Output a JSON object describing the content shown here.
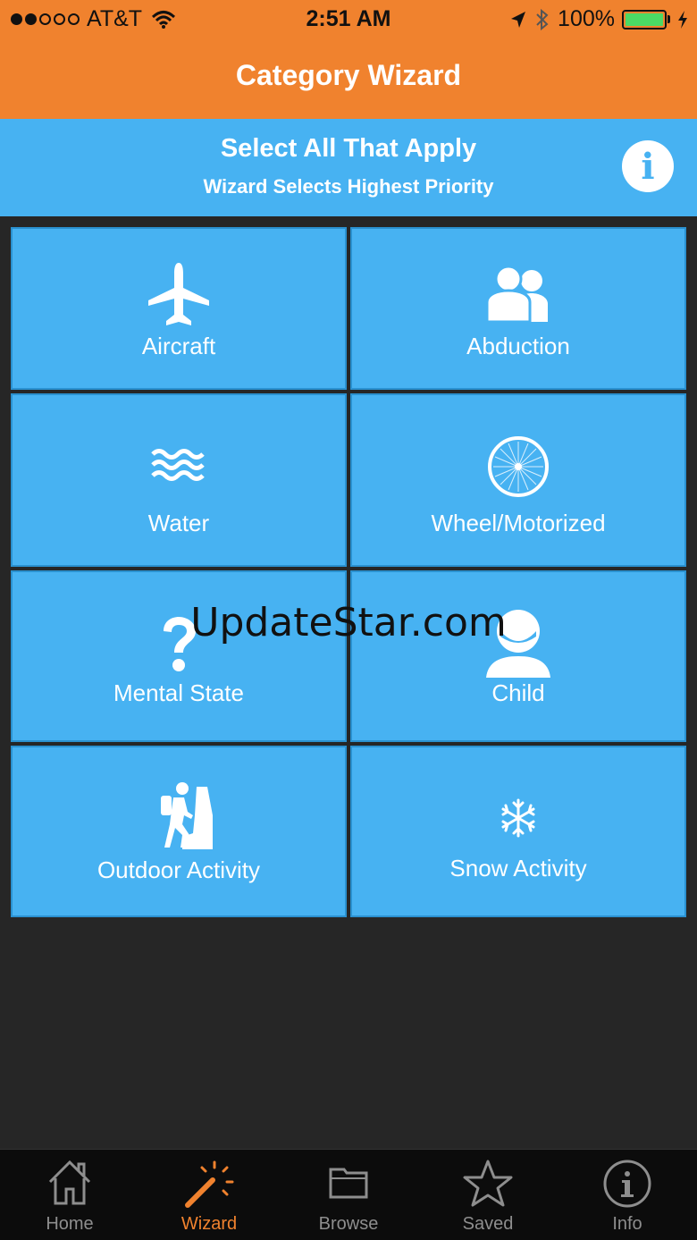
{
  "status_bar": {
    "carrier": "AT&T",
    "time": "2:51 AM",
    "battery": "100%"
  },
  "header": {
    "title": "Category Wizard"
  },
  "banner": {
    "title": "Select All That Apply",
    "subtitle": "Wizard Selects Highest Priority",
    "info_glyph": "i"
  },
  "tiles": [
    {
      "label": "Aircraft",
      "icon": "airplane-icon"
    },
    {
      "label": "Abduction",
      "icon": "people-icon"
    },
    {
      "label": "Water",
      "icon": "water-waves-icon"
    },
    {
      "label": "Wheel/Motorized",
      "icon": "wheel-icon"
    },
    {
      "label": "Mental State",
      "icon": "question-mark-icon"
    },
    {
      "label": "Child",
      "icon": "child-icon"
    },
    {
      "label": "Outdoor Activity",
      "icon": "hiker-icon"
    },
    {
      "label": "Snow Activity",
      "icon": "snowflake-icon"
    }
  ],
  "watermark": "UpdateStar.com",
  "tabbar": {
    "active": "Wizard",
    "tabs": [
      {
        "label": "Home",
        "icon": "home-icon"
      },
      {
        "label": "Wizard",
        "icon": "magic-wand-icon"
      },
      {
        "label": "Browse",
        "icon": "folder-icon"
      },
      {
        "label": "Saved",
        "icon": "star-icon"
      },
      {
        "label": "Info",
        "icon": "info-icon"
      }
    ]
  },
  "colors": {
    "header_orange": "#f0822e",
    "tile_blue": "#47b2f2",
    "background": "#262626",
    "tabbar": "#0c0c0c"
  }
}
